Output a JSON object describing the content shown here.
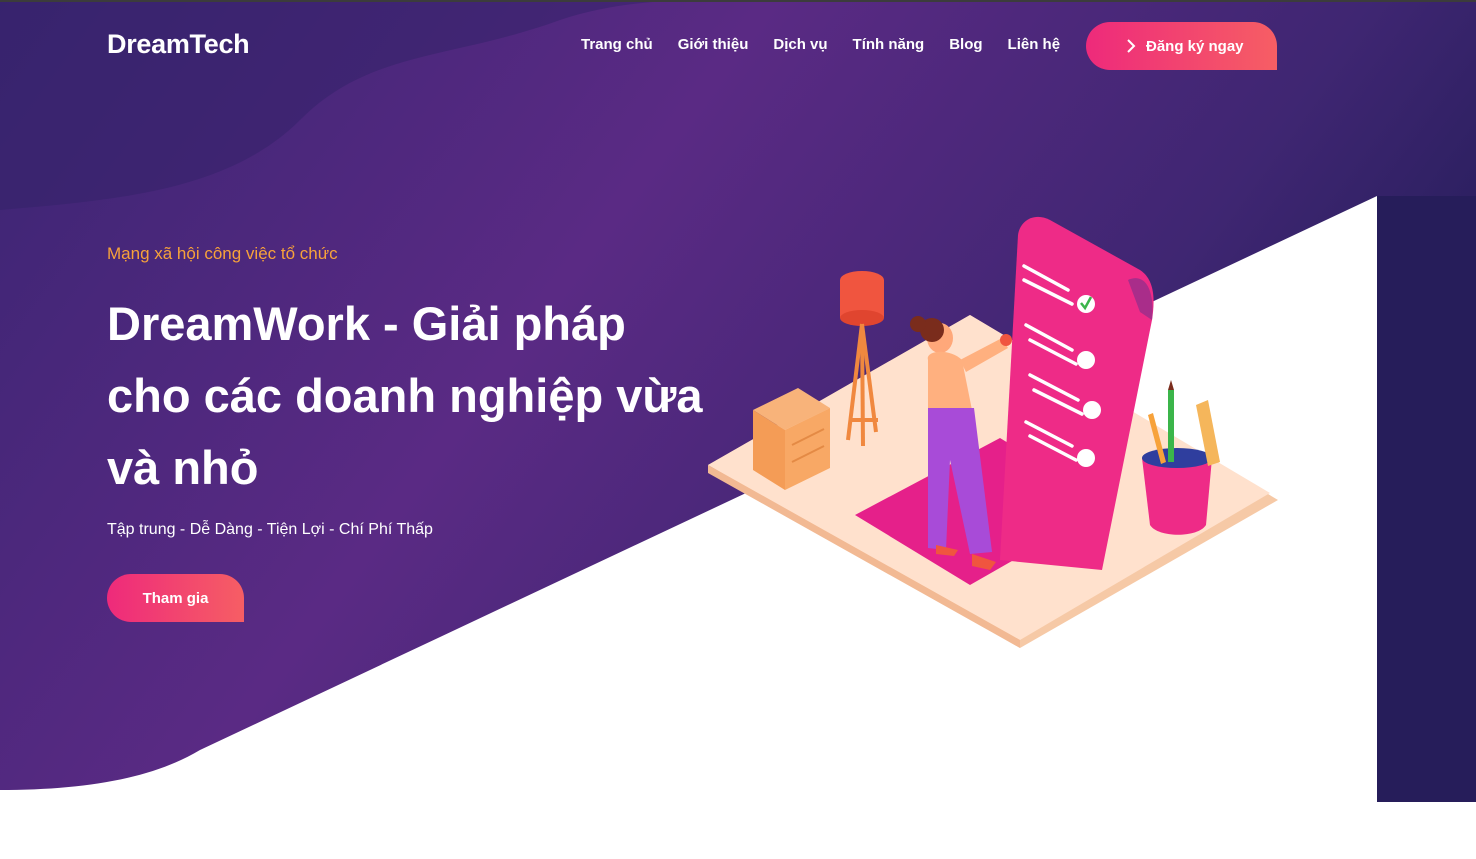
{
  "brand": {
    "name": "DreamTech"
  },
  "nav": {
    "items": [
      {
        "label": "Trang chủ"
      },
      {
        "label": "Giới thiệu"
      },
      {
        "label": "Dịch vụ"
      },
      {
        "label": "Tính năng"
      },
      {
        "label": "Blog"
      },
      {
        "label": "Liên hệ"
      }
    ],
    "cta_label": "Đăng ký ngay",
    "cta_icon": "chevron-right-icon"
  },
  "hero": {
    "kicker": "Mạng xã hội công việc tổ chức",
    "headline": "DreamWork - Giải pháp cho các doanh nghiệp vừa và nhỏ",
    "tagline": "Tập trung - Dễ Dàng - Tiện Lợi - Chí Phí Thấp",
    "button_label": "Tham gia"
  },
  "colors": {
    "hero_background": "#4a2a7e",
    "accent_gradient_start": "#ee2a7b",
    "accent_gradient_end": "#f65e64",
    "kicker_text": "#f7a23a"
  }
}
